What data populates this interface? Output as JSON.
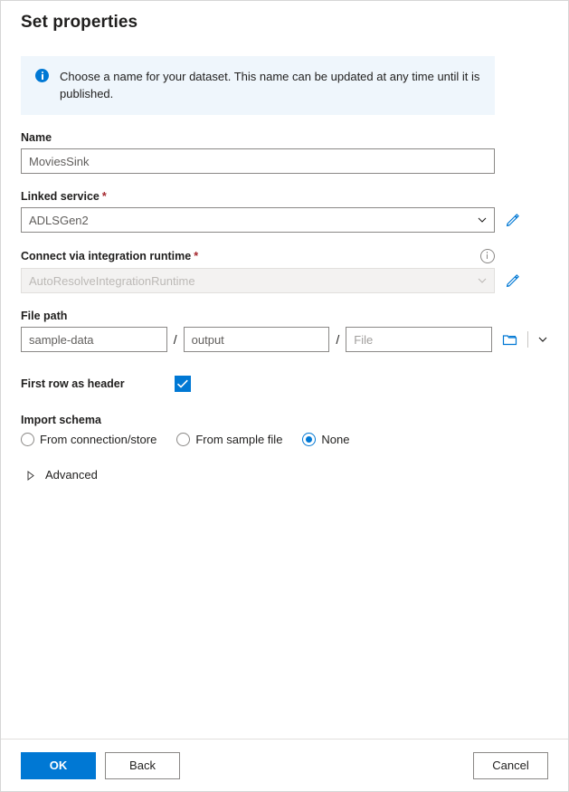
{
  "dialog": {
    "title": "Set properties"
  },
  "banner": {
    "icon": "info-filled-icon",
    "message": "Choose a name for your dataset. This name can be updated at any time until it is published."
  },
  "name_field": {
    "label": "Name",
    "value": "MoviesSink"
  },
  "linked_service": {
    "label": "Linked service",
    "required_marker": "*",
    "value": "ADLSGen2",
    "chevron_icon": "chevron-down-icon",
    "edit_icon": "pencil-icon"
  },
  "integration_runtime": {
    "label": "Connect via integration runtime",
    "required_marker": "*",
    "value": "AutoResolveIntegrationRuntime",
    "disabled": true,
    "info_icon": "info-outline-icon",
    "chevron_icon": "chevron-down-icon",
    "edit_icon": "pencil-icon"
  },
  "file_path": {
    "label": "File path",
    "container_value": "sample-data",
    "directory_value": "output",
    "file_value": "",
    "file_placeholder": "File",
    "separator": "/",
    "browse_icon": "folder-icon",
    "chevron_icon": "chevron-down-icon"
  },
  "first_row_as_header": {
    "label": "First row as header",
    "checked": true,
    "check_icon": "checkmark-icon"
  },
  "import_schema": {
    "label": "Import schema",
    "options": [
      {
        "label": "From connection/store",
        "selected": false
      },
      {
        "label": "From sample file",
        "selected": false
      },
      {
        "label": "None",
        "selected": true
      }
    ]
  },
  "advanced": {
    "label": "Advanced",
    "expanded": false,
    "chevron_icon": "triangle-right-icon"
  },
  "footer": {
    "ok_label": "OK",
    "back_label": "Back",
    "cancel_label": "Cancel"
  },
  "colors": {
    "accent": "#0078d4",
    "banner_bg": "#eff6fc",
    "required": "#a4262c",
    "border": "#8a8886",
    "disabled_bg": "#f3f2f1"
  }
}
